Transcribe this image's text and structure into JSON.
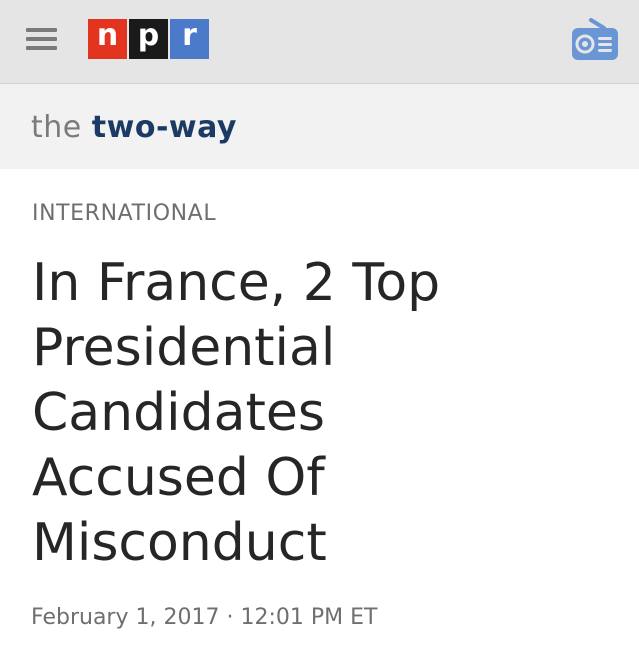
{
  "header": {
    "menu_icon": "hamburger-menu-icon",
    "logo": {
      "letters": [
        "n",
        "p",
        "r"
      ],
      "colors": [
        "#e3341f",
        "#1a1a1a",
        "#4a7ac9"
      ]
    },
    "radio_icon": "radio-icon",
    "accent_color": "#6b96d6"
  },
  "blog": {
    "prefix": "the",
    "name": "two-way"
  },
  "article": {
    "section": "INTERNATIONAL",
    "headline_lines": [
      "In France, 2 Top",
      "Presidential",
      "Candidates",
      "Accused Of",
      "Misconduct"
    ],
    "date": "February 1, 2017",
    "separator": "·",
    "time": "12:01 PM ET"
  }
}
